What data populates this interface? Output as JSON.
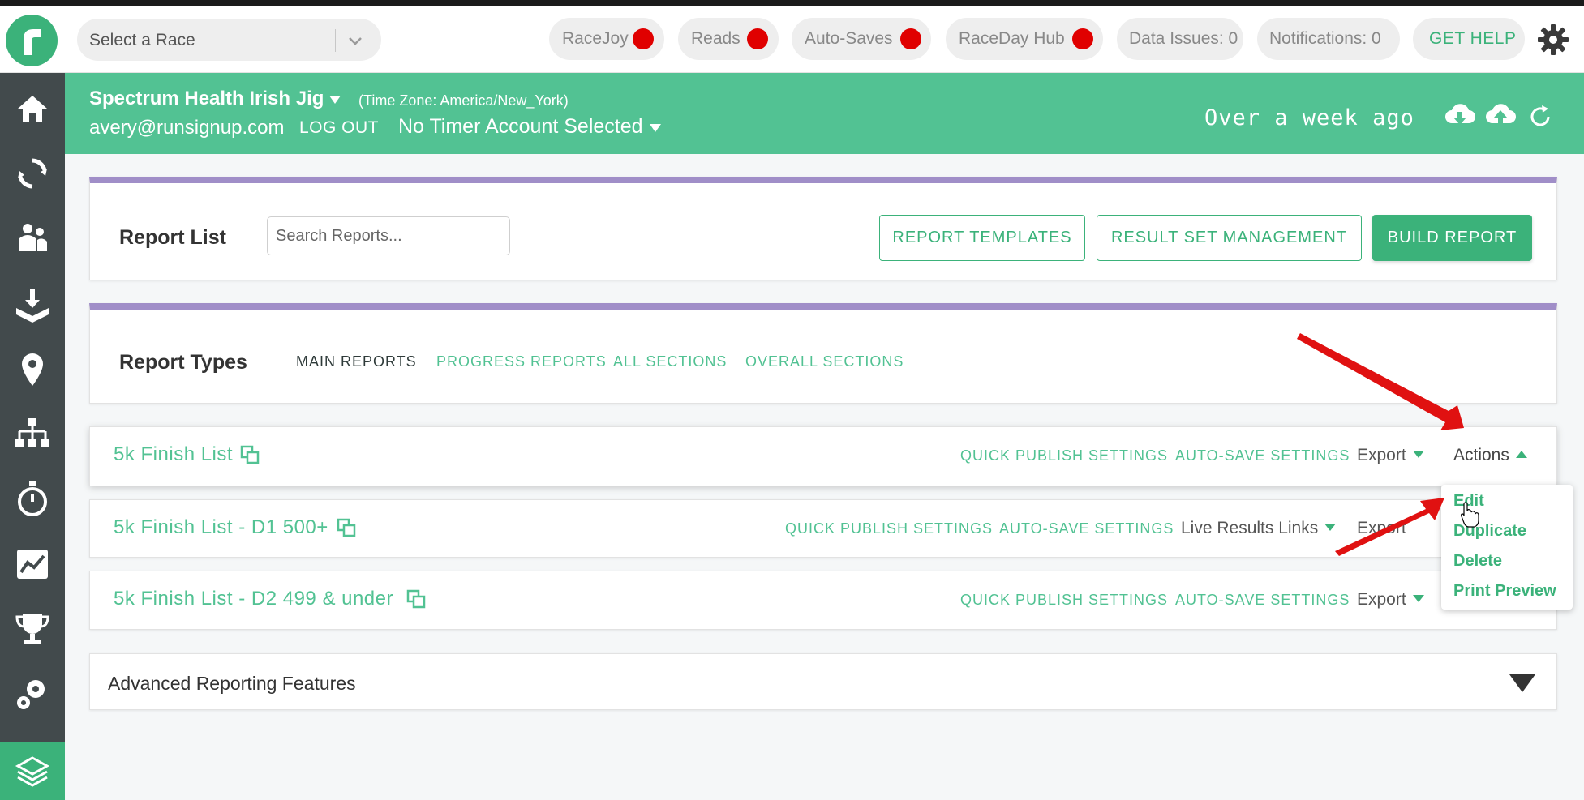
{
  "colors": {
    "brand": "#3bb27a",
    "header": "#52c293",
    "sidebar": "#424a4c",
    "status_dot": "#e00000",
    "accent_border": "#a08ec8",
    "arrow": "#e01111"
  },
  "topbar": {
    "race_select": {
      "placeholder": "Select a Race"
    },
    "indicators": [
      {
        "label": "RaceJoy"
      },
      {
        "label": "Reads"
      },
      {
        "label": "Auto-Saves"
      },
      {
        "label": "RaceDay Hub"
      }
    ],
    "counters": [
      {
        "label": "Data Issues: 0"
      },
      {
        "label": "Notifications: 0"
      }
    ],
    "help_label": "GET HELP",
    "settings_icon": "gear-icon"
  },
  "sidebar": {
    "icons": [
      "home-icon",
      "sync-icon",
      "participants-icon",
      "import-icon",
      "location-icon",
      "hierarchy-icon",
      "stopwatch-icon",
      "chart-icon",
      "trophy-icon",
      "settings-icon",
      "layers-icon"
    ]
  },
  "header": {
    "race_name": "Spectrum Health Irish Jig",
    "timezone": "(Time Zone: America/New_York)",
    "email": "avery@runsignup.com",
    "logout": "LOG OUT",
    "timer_account": "No Timer Account Selected",
    "last_sync": "Over a week ago"
  },
  "report_list": {
    "title": "Report List",
    "search_placeholder": "Search Reports...",
    "buttons": {
      "templates": "REPORT TEMPLATES",
      "result_sets": "RESULT SET MANAGEMENT",
      "build": "BUILD REPORT"
    }
  },
  "report_types": {
    "title": "Report Types",
    "tabs": [
      {
        "label": "MAIN REPORTS",
        "active": true
      },
      {
        "label": "PROGRESS REPORTS"
      },
      {
        "label": "ALL SECTIONS"
      },
      {
        "label": "OVERALL SECTIONS"
      }
    ]
  },
  "reports": [
    {
      "title": "5k Finish List",
      "quick_publish": "QUICK PUBLISH SETTINGS",
      "auto_save": "AUTO-SAVE SETTINGS",
      "export": "Export",
      "actions": "Actions"
    },
    {
      "title": "5k Finish List - D1 500+",
      "quick_publish": "QUICK PUBLISH SETTINGS",
      "auto_save": "AUTO-SAVE SETTINGS",
      "live_links": "Live Results Links",
      "export": "Export"
    },
    {
      "title": "5k Finish List - D2 499 & under",
      "quick_publish": "QUICK PUBLISH SETTINGS",
      "auto_save": "AUTO-SAVE SETTINGS",
      "export": "Export"
    }
  ],
  "actions_menu": {
    "items": [
      "Edit",
      "Duplicate",
      "Delete",
      "Print Preview"
    ]
  },
  "advanced": {
    "title": "Advanced Reporting Features"
  }
}
